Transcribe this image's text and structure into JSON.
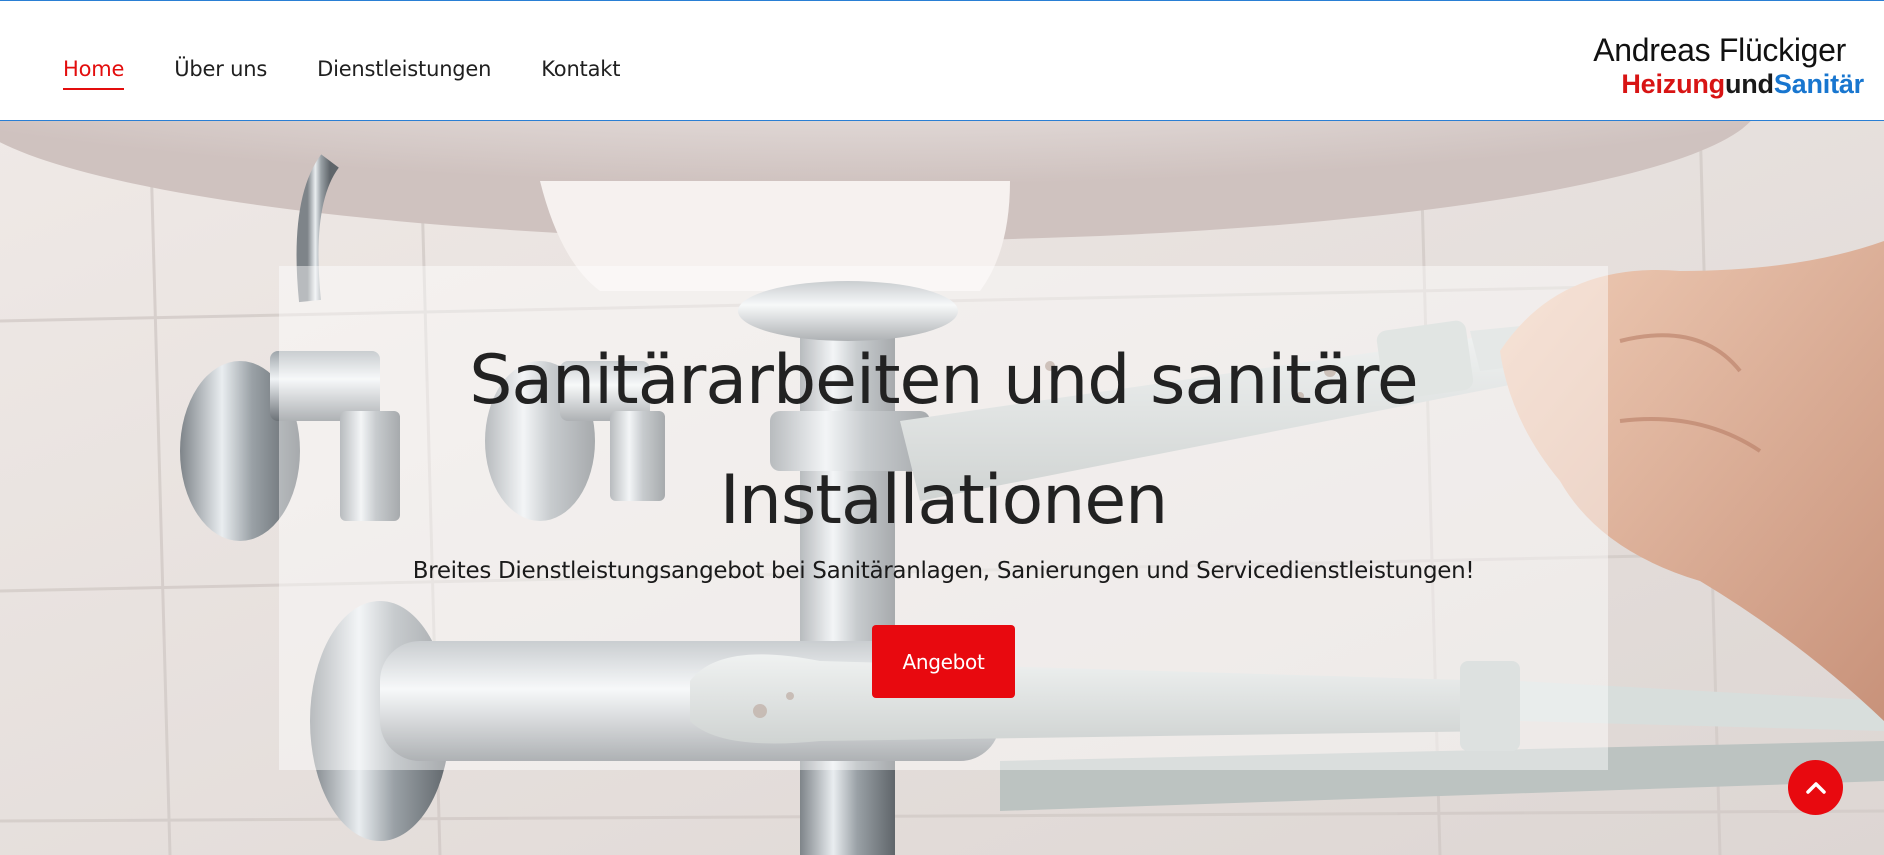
{
  "header": {
    "nav": [
      {
        "label": "Home",
        "active": true
      },
      {
        "label": "Über uns",
        "active": false
      },
      {
        "label": "Dienstleistungen",
        "active": false
      },
      {
        "label": "Kontakt",
        "active": false
      }
    ],
    "logo": {
      "line1": "Andreas Flückiger",
      "part_red": "Heizung",
      "part_dark": "und",
      "part_blue": "Sanitär"
    }
  },
  "hero": {
    "title": "Sanitärarbeiten und sanitäre Installationen",
    "subtitle": "Breites Dienstleistungsangebot bei Sanitäranlagen, Sanierungen und Servicedienstleistungen!",
    "cta_label": "Angebot",
    "background_image": "plumber-wrench-under-sink-photo"
  },
  "scroll_top": {
    "icon": "chevron-up-icon"
  },
  "colors": {
    "accent_red": "#e8090f",
    "header_border_blue": "#2a7fd4",
    "logo_blue": "#1876cf",
    "logo_red": "#d81414",
    "text_dark": "#222222"
  }
}
